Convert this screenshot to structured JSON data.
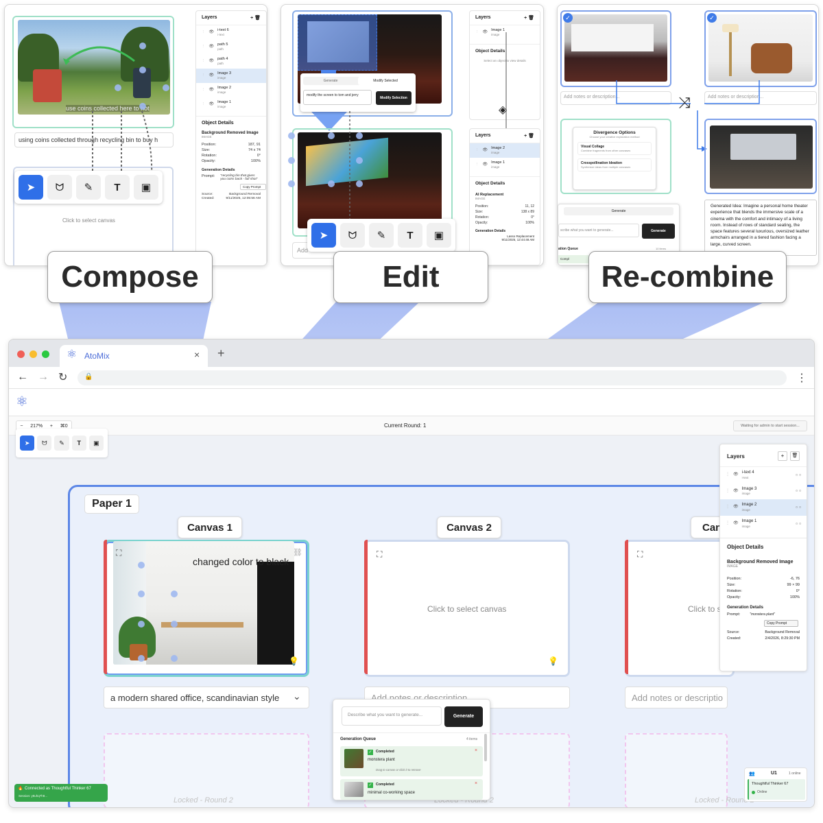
{
  "labels": {
    "compose": "Compose",
    "edit": "Edit",
    "recombine": "Re-combine"
  },
  "compose": {
    "prompt_text": "using coins collected through recycling bin to buy h",
    "overlay_text": "use coins collected here to hot",
    "click_select": "Click to select canvas",
    "layers_title": "Layers",
    "layers": [
      {
        "name": "i-text 6",
        "type": "i-text"
      },
      {
        "name": "path 5",
        "type": "path"
      },
      {
        "name": "path 4",
        "type": "path"
      },
      {
        "name": "Image 3",
        "type": "image"
      },
      {
        "name": "Image 2",
        "type": "image"
      },
      {
        "name": "Image 1",
        "type": "image"
      }
    ],
    "details": {
      "title": "Object Details",
      "obj_title": "Background Removed Image",
      "obj_type": "IMAGE",
      "position_k": "Position:",
      "position_v": "187, 91",
      "size_k": "Size:",
      "size_v": "74 x 74",
      "rotation_k": "Rotation:",
      "rotation_v": "0°",
      "opacity_k": "Opacity:",
      "opacity_v": "100%",
      "gen_title": "Generation Details",
      "prompt_k": "Prompt:",
      "prompt_v": "\"recycling bin that gives you coins back - full shot\"",
      "copy": "Copy Prompt",
      "source_k": "Source:",
      "source_v": "Background Removal",
      "created_k": "Created:",
      "created_v": "9/11/2025, 12:05:56 AM"
    }
  },
  "edit": {
    "tab_generate": "Generate",
    "tab_modify": "Modify Selected",
    "input_text": "modify the screen to tom and jerry",
    "modify_btn": "Modify Selection",
    "add_text": "Add",
    "layers_title": "Layers",
    "top_layers": [
      {
        "name": "Image 1",
        "type": "image"
      }
    ],
    "top_details_title": "Object Details",
    "top_details_hint": "Select an object to view details",
    "bottom_layers": [
      {
        "name": "Image 2",
        "type": "image"
      },
      {
        "name": "Image 1",
        "type": "image"
      }
    ],
    "details": {
      "title": "Object Details",
      "obj_title": "AI Replacement",
      "obj_type": "IMAGE",
      "position_k": "Position:",
      "position_v": "11, 12",
      "size_k": "Size:",
      "size_v": "138 x 89",
      "rotation_k": "Rotation:",
      "rotation_v": "0°",
      "opacity_k": "Opacity:",
      "opacity_v": "100%",
      "gen_title": "Generation Details",
      "source_v": "Lasso Replacement",
      "created_v": "9/11/2025, 12:44:48 AM"
    }
  },
  "recombine": {
    "note1": "Add notes or description...",
    "note2": "Add notes or description...",
    "divergence_title": "Divergence Options",
    "divergence_sub": "Choose your creative exploration method",
    "opt1_title": "Visual Collage",
    "opt1_sub": "Combine fragments from other canvases",
    "opt2_title": "Crosspollination Ideation",
    "opt2_sub": "Synthesize ideas from multiple canvases",
    "gen_tab": "Generate",
    "gen_placeholder": "scribe what you want to generate...",
    "gen_btn": "Generate",
    "queue": "ation Queue",
    "queue_count": "10 items",
    "queue_item": "Compl",
    "idea": "Generated Idea: Imagine a personal home theater experience that blends the immersive scale of a cinema with the comfort and intimacy of a living room. Instead of rows of standard seating, the space features several luxurious, oversized leather armchairs arranged in a tiered fashion facing a large, curved screen."
  },
  "browser": {
    "tab_title": "AtoMix",
    "current_round": "Current Round: 1",
    "waiting": "Waiting for admin to start session...",
    "zoom_minus": "−",
    "zoom": "217%",
    "zoom_plus": "+",
    "shortcut": "⌘0",
    "paper": "Paper 1",
    "canvas1": "Canvas 1",
    "canvas2": "Canvas 2",
    "canvas3": "Can",
    "canvas1_overlay": "changed color to black",
    "click_select": "Click to select canvas",
    "click_select_partial": "Click to s",
    "canvas1_note": "a modern shared office, scandinavian style",
    "canvas2_note": "Add notes or description...",
    "canvas3_note": "Add notes or descriptio",
    "locked": "Locked - Round 2",
    "generate_placeholder": "Describe what you want to generate...",
    "generate_btn": "Generate",
    "queue_title": "Generation Queue",
    "queue_count": "4 items",
    "queue": [
      {
        "status": "Completed",
        "name": "monstera plant",
        "hint": "Drag to canvas or click it to remove"
      },
      {
        "status": "Completed",
        "name": "minimal co-working space"
      }
    ],
    "layers_title": "Layers",
    "layers": [
      {
        "name": "i-text 4",
        "type": "i-text"
      },
      {
        "name": "Image 3",
        "type": "image"
      },
      {
        "name": "Image 2",
        "type": "image"
      },
      {
        "name": "Image 1",
        "type": "image"
      }
    ],
    "details": {
      "title": "Object Details",
      "obj_title": "Background Removed Image",
      "obj_type": "IMAGE",
      "position_k": "Position:",
      "position_v": "-6, 76",
      "size_k": "Size:",
      "size_v": "99 × 99",
      "rotation_k": "Rotation:",
      "rotation_v": "0°",
      "opacity_k": "Opacity:",
      "opacity_v": "100%",
      "gen_title": "Generation Details",
      "prompt_k": "Prompt:",
      "prompt_v": "\"monstera plant\"",
      "copy": "Copy Prompt",
      "source_k": "Source:",
      "source_v": "Background Removal",
      "created_k": "Created:",
      "created_v": "2/4/2026, 8:29:30 PM"
    },
    "users_title": "U1",
    "users_count": "1 online",
    "user_name": "Thoughtful Thinker 67",
    "user_status": "Online",
    "connected": "Connected as Thoughtful Thinker 67",
    "session": "Session: y8uhq7h9..."
  }
}
